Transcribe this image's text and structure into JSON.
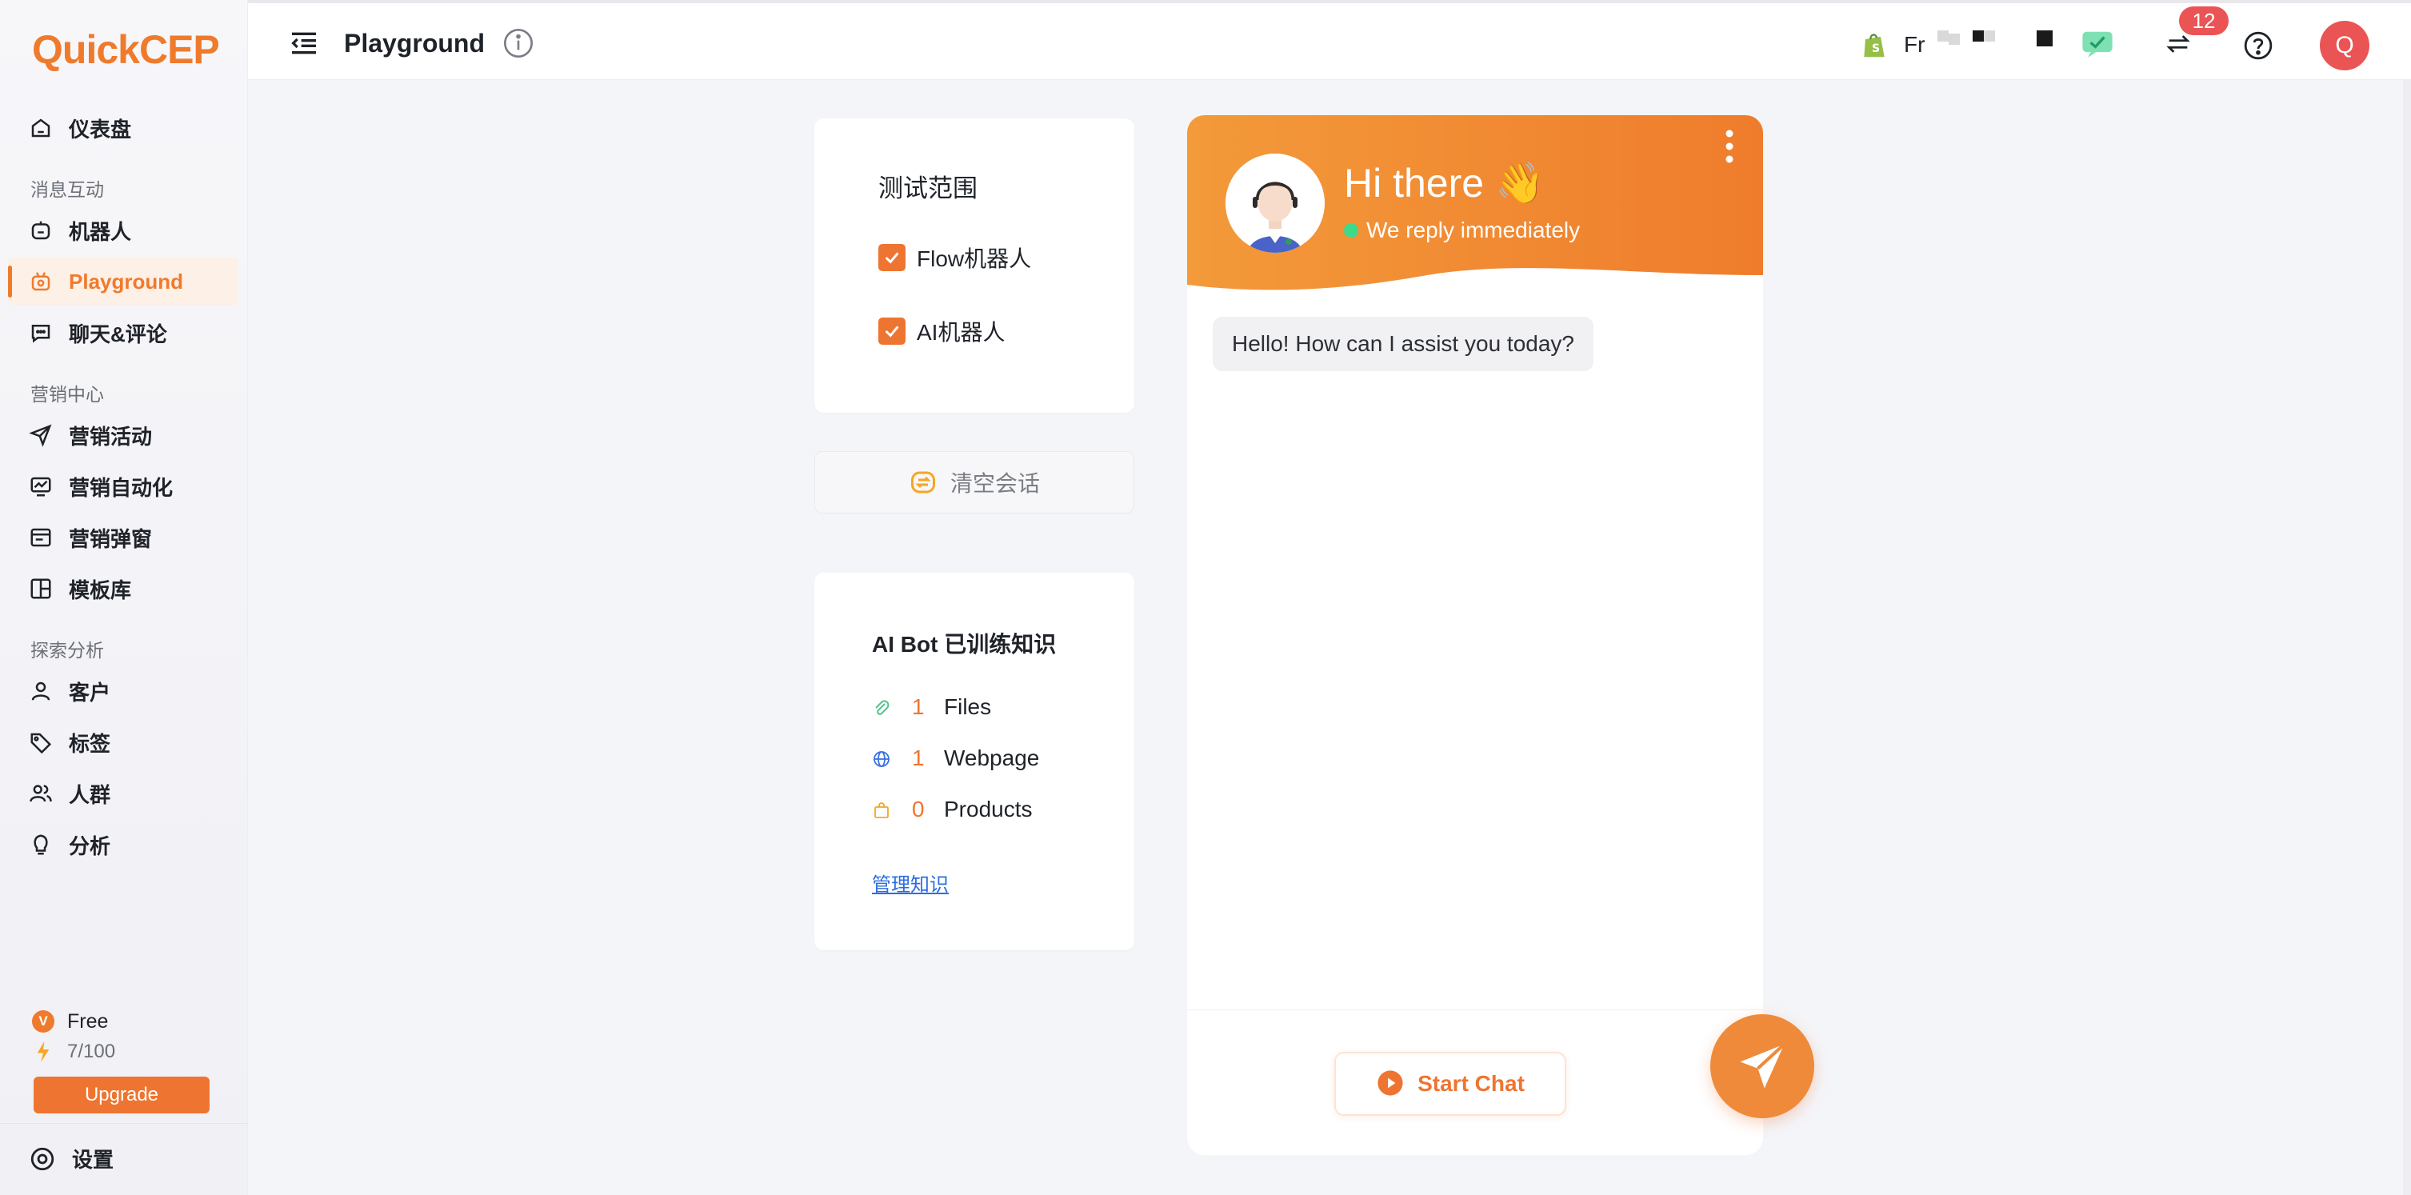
{
  "brand": {
    "logo_q": "Q",
    "logo_rest": "uickCEP",
    "accent": "#ee7531"
  },
  "sidebar": {
    "items": [
      {
        "label": "仪表盘",
        "icon": "home-icon"
      },
      {
        "label": "机器人",
        "icon": "robot-icon"
      },
      {
        "label": "Playground",
        "icon": "playground-icon",
        "active": true
      },
      {
        "label": "聊天&评论",
        "icon": "chat-icon"
      },
      {
        "label": "营销活动",
        "icon": "send-icon"
      },
      {
        "label": "营销自动化",
        "icon": "automation-icon"
      },
      {
        "label": "营销弹窗",
        "icon": "popup-icon"
      },
      {
        "label": "模板库",
        "icon": "template-icon"
      },
      {
        "label": "客户",
        "icon": "user-icon"
      },
      {
        "label": "标签",
        "icon": "tag-icon"
      },
      {
        "label": "人群",
        "icon": "users-icon"
      },
      {
        "label": "分析",
        "icon": "bulb-icon"
      }
    ],
    "sections": [
      "消息互动",
      "营销中心",
      "探索分析"
    ],
    "plan": {
      "badge": "V",
      "name": "Free",
      "usage": "7/100"
    },
    "upgrade_label": "Upgrade",
    "settings_label": "设置"
  },
  "header": {
    "title": "Playground",
    "shop_name": "Fr",
    "notification_count": "12",
    "user_initial": "Q"
  },
  "scope": {
    "title": "测试范围",
    "options": [
      {
        "label": "Flow机器人",
        "checked": true
      },
      {
        "label": "AI机器人",
        "checked": true
      }
    ]
  },
  "clear_button": "清空会话",
  "knowledge": {
    "title": "AI Bot 已训练知识",
    "rows": [
      {
        "count": "1",
        "label": "Files",
        "icon": "paperclip-icon"
      },
      {
        "count": "1",
        "label": "Webpage",
        "icon": "globe-icon"
      },
      {
        "count": "0",
        "label": "Products",
        "icon": "bag-icon"
      }
    ],
    "manage_link": "管理知识"
  },
  "chat": {
    "greeting": "Hi there 👋",
    "status": "We reply immediately",
    "message": "Hello! How can I assist you today?",
    "start_label": "Start Chat"
  }
}
